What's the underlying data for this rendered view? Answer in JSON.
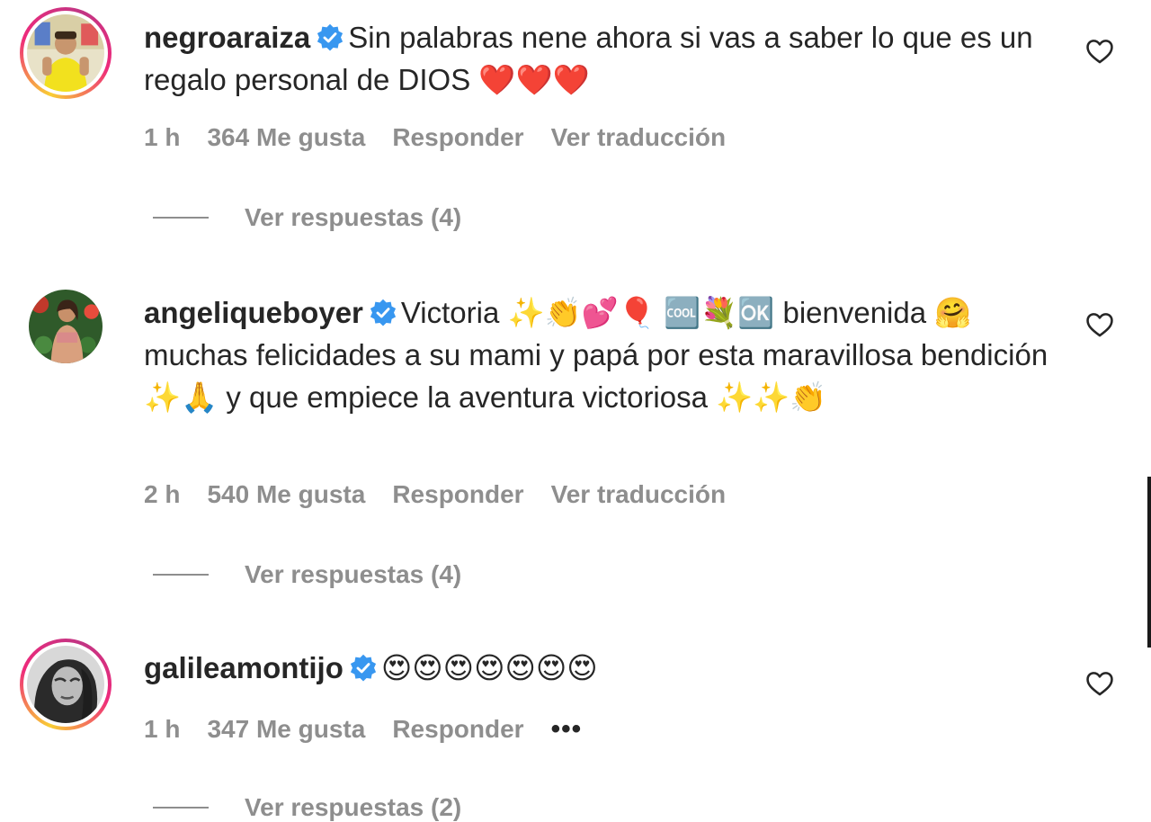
{
  "comments": [
    {
      "username": "negroaraiza",
      "verified": true,
      "text": "Sin palabras nene ahora si vas a saber lo que es un regalo personal de DIOS ❤️❤️❤️",
      "time": "1 h",
      "likes": "364 Me gusta",
      "reply_label": "Responder",
      "extra_action": "Ver traducción",
      "view_replies": "Ver respuestas (4)",
      "story_ring": true
    },
    {
      "username": "angeliqueboyer",
      "verified": true,
      "text": "Victoria ✨👏💕🎈 🆒💐🆗 bienvenida 🤗 muchas felicidades a su mami y papá por esta maravillosa bendición ✨🙏 y que empiece la aventura victoriosa ✨✨👏",
      "time": "2 h",
      "likes": "540 Me gusta",
      "reply_label": "Responder",
      "extra_action": "Ver traducción",
      "view_replies": "Ver respuestas (4)",
      "story_ring": false
    },
    {
      "username": "galileamontijo",
      "verified": true,
      "text": "😍😍😍😍😍😍😍",
      "time": "1 h",
      "likes": "347 Me gusta",
      "reply_label": "Responder",
      "extra_action": "•••",
      "view_replies": "Ver respuestas (2)",
      "story_ring": true
    }
  ],
  "icons": {
    "like": "heart-outline-icon",
    "verified": "verified-badge-icon",
    "more": "more-options-icon"
  },
  "colors": {
    "primary_text": "#262626",
    "secondary_text": "#8e8e8e",
    "verified_blue": "#3897f0"
  }
}
